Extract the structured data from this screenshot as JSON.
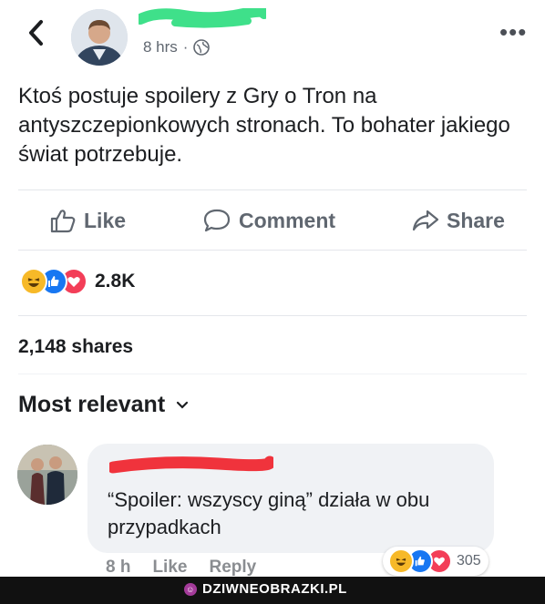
{
  "post": {
    "time": "8 hrs",
    "visibility_separator": "·",
    "text": "Ktoś postuje spoilery z Gry o Tron na antyszczepionkowych stronach. To bohater jakiego świat potrzebuje."
  },
  "actions": {
    "like": "Like",
    "comment": "Comment",
    "share": "Share"
  },
  "reactions": {
    "types": [
      "haha-icon",
      "like-icon",
      "love-icon"
    ],
    "count": "2.8K"
  },
  "shares": "2,148 shares",
  "comments": {
    "sort_label": "Most relevant",
    "items": [
      {
        "text": "“Spoiler: wszyscy giną” działa w obu przypadkach",
        "time": "8 h",
        "like": "Like",
        "reply": "Reply",
        "reaction_count": "305"
      }
    ]
  },
  "watermark": {
    "text": "DZIWNEOBRAZKI.PL"
  },
  "colors": {
    "redaction": "#f0333c",
    "redaction_green": "#3fe08a",
    "accent": "#1877f2",
    "love": "#f33e58",
    "haha": "#f7b928"
  }
}
